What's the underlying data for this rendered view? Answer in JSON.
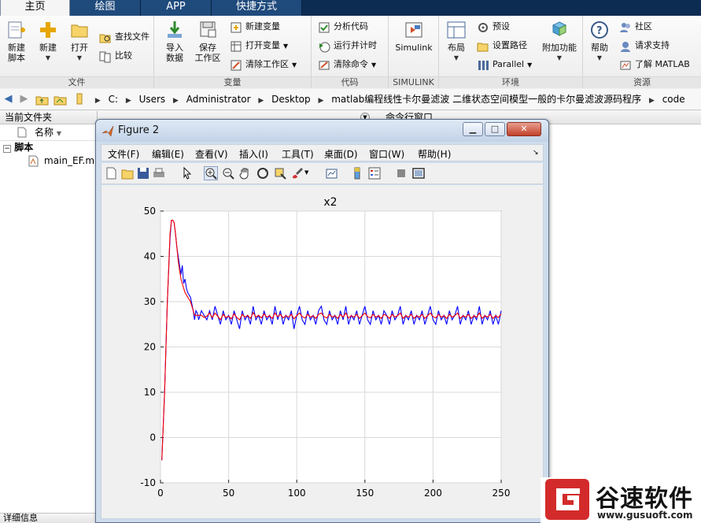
{
  "tabs": [
    "主页",
    "绘图",
    "APP",
    "快捷方式"
  ],
  "ribbon": {
    "file_group": {
      "label": "文件",
      "new_script": "新建\n脚本",
      "new": "新建",
      "open": "打开",
      "find_files": "查找文件",
      "compare": "比较"
    },
    "variable_group": {
      "label": "变量",
      "import_data": "导入\n数据",
      "save_workspace": "保存\n工作区",
      "new_variable": "新建变量",
      "open_variable": "打开变量",
      "clear_workspace": "清除工作区"
    },
    "code_group": {
      "label": "代码",
      "analyze_code": "分析代码",
      "run_and_time": "运行并计时",
      "clear_commands": "清除命令"
    },
    "simulink_group": {
      "label": "SIMULINK",
      "simulink": "Simulink"
    },
    "environment_group": {
      "label": "环境",
      "layout": "布局",
      "preferences": "预设",
      "set_path": "设置路径",
      "parallel": "Parallel",
      "addons": "附加功能"
    },
    "resources_group": {
      "label": "资源",
      "help": "帮助",
      "community": "社区",
      "request_support": "请求支持",
      "learn_matlab": "了解 MATLAB"
    }
  },
  "address": {
    "crumbs": [
      "C:",
      "Users",
      "Administrator",
      "Desktop",
      "matlab编程线性卡尔曼滤波 二维状态空间模型一般的卡尔曼滤波源码程序",
      "code"
    ]
  },
  "left_panel": {
    "title": "当前文件夹",
    "name_column": "名称",
    "section": "脚本",
    "file": "main_EF.m",
    "details": "详细信息"
  },
  "command_window": {
    "title": "命令行窗口"
  },
  "figure": {
    "title": "Figure 2",
    "menu": [
      "文件(F)",
      "编辑(E)",
      "查看(V)",
      "插入(I)",
      "工具(T)",
      "桌面(D)",
      "窗口(W)",
      "帮助(H)"
    ],
    "window_buttons": {
      "minimize": "▁",
      "maximize": "□",
      "close": "✕"
    }
  },
  "chart_data": {
    "type": "line",
    "title": "x2",
    "xlabel": "",
    "ylabel": "",
    "xlim": [
      0,
      250
    ],
    "ylim": [
      -10,
      50
    ],
    "xticks": [
      0,
      50,
      100,
      150,
      200,
      250
    ],
    "yticks": [
      -10,
      0,
      10,
      20,
      30,
      40,
      50
    ],
    "grid": true,
    "series": [
      {
        "color": "#0000ff",
        "points": [
          [
            1,
            -5
          ],
          [
            3,
            10
          ],
          [
            5,
            30
          ],
          [
            7,
            44
          ],
          [
            8,
            48
          ],
          [
            9,
            48
          ],
          [
            10,
            47.5
          ],
          [
            11,
            45
          ],
          [
            12,
            42
          ],
          [
            13,
            40
          ],
          [
            14,
            38
          ],
          [
            15,
            36
          ],
          [
            16,
            38
          ],
          [
            17,
            34
          ],
          [
            18,
            35
          ],
          [
            19,
            33
          ],
          [
            20,
            32
          ],
          [
            22,
            31
          ],
          [
            24,
            28
          ],
          [
            25,
            26
          ],
          [
            26,
            28
          ],
          [
            27,
            27.5
          ],
          [
            28,
            26
          ],
          [
            30,
            28
          ],
          [
            32,
            27
          ],
          [
            34,
            26
          ],
          [
            36,
            28
          ],
          [
            38,
            26
          ],
          [
            40,
            29
          ],
          [
            42,
            27
          ],
          [
            44,
            25
          ],
          [
            46,
            28
          ],
          [
            48,
            26
          ],
          [
            50,
            27
          ],
          [
            52,
            25
          ],
          [
            54,
            28
          ],
          [
            56,
            26
          ],
          [
            58,
            24
          ],
          [
            60,
            28
          ],
          [
            62,
            26
          ],
          [
            64,
            27
          ],
          [
            66,
            25
          ],
          [
            68,
            29
          ],
          [
            70,
            26
          ],
          [
            72,
            27
          ],
          [
            74,
            25
          ],
          [
            76,
            28
          ],
          [
            78,
            26
          ],
          [
            80,
            27
          ],
          [
            82,
            25
          ],
          [
            84,
            29
          ],
          [
            86,
            26
          ],
          [
            88,
            28
          ],
          [
            90,
            25
          ],
          [
            92,
            27
          ],
          [
            94,
            26
          ],
          [
            96,
            28
          ],
          [
            98,
            24
          ],
          [
            100,
            27
          ],
          [
            102,
            29
          ],
          [
            104,
            26
          ],
          [
            106,
            25
          ],
          [
            108,
            28
          ],
          [
            110,
            26
          ],
          [
            112,
            27
          ],
          [
            114,
            25
          ],
          [
            116,
            28
          ],
          [
            118,
            29
          ],
          [
            120,
            26
          ],
          [
            122,
            25
          ],
          [
            124,
            28
          ],
          [
            126,
            26
          ],
          [
            128,
            27
          ],
          [
            130,
            25
          ],
          [
            132,
            28
          ],
          [
            134,
            26
          ],
          [
            136,
            29
          ],
          [
            138,
            25
          ],
          [
            140,
            27
          ],
          [
            142,
            26
          ],
          [
            144,
            28
          ],
          [
            146,
            25
          ],
          [
            148,
            27
          ],
          [
            150,
            29
          ],
          [
            152,
            26
          ],
          [
            154,
            25
          ],
          [
            156,
            28
          ],
          [
            158,
            26
          ],
          [
            160,
            27
          ],
          [
            162,
            25
          ],
          [
            164,
            28
          ],
          [
            166,
            27
          ],
          [
            168,
            25
          ],
          [
            170,
            28
          ],
          [
            172,
            26
          ],
          [
            174,
            27
          ],
          [
            176,
            29
          ],
          [
            178,
            25
          ],
          [
            180,
            27
          ],
          [
            182,
            26
          ],
          [
            184,
            28
          ],
          [
            186,
            25
          ],
          [
            188,
            27
          ],
          [
            190,
            26
          ],
          [
            192,
            28
          ],
          [
            194,
            25
          ],
          [
            196,
            27
          ],
          [
            198,
            29
          ],
          [
            200,
            26
          ],
          [
            202,
            25
          ],
          [
            204,
            28
          ],
          [
            206,
            26
          ],
          [
            208,
            27
          ],
          [
            210,
            25
          ],
          [
            212,
            28
          ],
          [
            214,
            26
          ],
          [
            216,
            27
          ],
          [
            218,
            29
          ],
          [
            220,
            25
          ],
          [
            222,
            27
          ],
          [
            224,
            26
          ],
          [
            226,
            28
          ],
          [
            228,
            25
          ],
          [
            230,
            27
          ],
          [
            232,
            26
          ],
          [
            234,
            29
          ],
          [
            236,
            25
          ],
          [
            238,
            27
          ],
          [
            240,
            26
          ],
          [
            242,
            28
          ],
          [
            244,
            25
          ],
          [
            246,
            27
          ],
          [
            248,
            25
          ],
          [
            250,
            28
          ]
        ]
      },
      {
        "color": "#ff0000",
        "points": [
          [
            1,
            -5
          ],
          [
            3,
            10
          ],
          [
            5,
            30
          ],
          [
            7,
            45
          ],
          [
            8,
            48
          ],
          [
            9,
            48
          ],
          [
            10,
            47.5
          ],
          [
            11,
            45
          ],
          [
            12,
            42
          ],
          [
            13,
            39
          ],
          [
            14,
            37
          ],
          [
            15,
            35
          ],
          [
            16,
            34
          ],
          [
            17,
            33
          ],
          [
            18,
            32
          ],
          [
            20,
            31
          ],
          [
            22,
            30
          ],
          [
            24,
            28
          ],
          [
            25,
            27
          ],
          [
            26,
            27
          ],
          [
            28,
            27
          ],
          [
            30,
            27
          ],
          [
            32,
            26.5
          ],
          [
            34,
            26.8
          ],
          [
            36,
            27.5
          ],
          [
            38,
            26.5
          ],
          [
            40,
            27.5
          ],
          [
            42,
            26.8
          ],
          [
            44,
            26
          ],
          [
            46,
            27.2
          ],
          [
            48,
            26.5
          ],
          [
            50,
            26.8
          ],
          [
            52,
            26.2
          ],
          [
            54,
            27.3
          ],
          [
            56,
            26.5
          ],
          [
            58,
            26
          ],
          [
            60,
            27.2
          ],
          [
            62,
            26.6
          ],
          [
            64,
            27
          ],
          [
            66,
            26.3
          ],
          [
            68,
            27.6
          ],
          [
            70,
            26.6
          ],
          [
            72,
            27
          ],
          [
            74,
            26.4
          ],
          [
            76,
            27.3
          ],
          [
            78,
            26.6
          ],
          [
            80,
            26.9
          ],
          [
            82,
            26.3
          ],
          [
            84,
            27.5
          ],
          [
            86,
            26.7
          ],
          [
            88,
            27.2
          ],
          [
            90,
            26.4
          ],
          [
            92,
            26.9
          ],
          [
            94,
            26.6
          ],
          [
            96,
            27.2
          ],
          [
            98,
            26.2
          ],
          [
            100,
            26.9
          ],
          [
            102,
            27.5
          ],
          [
            104,
            26.7
          ],
          [
            106,
            26.4
          ],
          [
            108,
            27.2
          ],
          [
            110,
            26.6
          ],
          [
            112,
            26.9
          ],
          [
            114,
            26.3
          ],
          [
            116,
            27.2
          ],
          [
            118,
            27.5
          ],
          [
            120,
            26.7
          ],
          [
            122,
            26.4
          ],
          [
            124,
            27.2
          ],
          [
            126,
            26.6
          ],
          [
            128,
            26.9
          ],
          [
            130,
            26.3
          ],
          [
            132,
            27.2
          ],
          [
            134,
            26.6
          ],
          [
            136,
            27.5
          ],
          [
            138,
            26.4
          ],
          [
            140,
            26.9
          ],
          [
            142,
            26.6
          ],
          [
            144,
            27.2
          ],
          [
            146,
            26.3
          ],
          [
            148,
            26.9
          ],
          [
            150,
            27.5
          ],
          [
            152,
            26.7
          ],
          [
            154,
            26.4
          ],
          [
            156,
            27.2
          ],
          [
            158,
            26.6
          ],
          [
            160,
            26.9
          ],
          [
            162,
            26.3
          ],
          [
            164,
            27.2
          ],
          [
            166,
            26.9
          ],
          [
            168,
            26.3
          ],
          [
            170,
            27.2
          ],
          [
            172,
            26.6
          ],
          [
            174,
            26.9
          ],
          [
            176,
            27.5
          ],
          [
            178,
            26.3
          ],
          [
            180,
            26.9
          ],
          [
            182,
            26.6
          ],
          [
            184,
            27.2
          ],
          [
            186,
            26.3
          ],
          [
            188,
            26.9
          ],
          [
            190,
            26.6
          ],
          [
            192,
            27.2
          ],
          [
            194,
            26.3
          ],
          [
            196,
            26.9
          ],
          [
            198,
            27.5
          ],
          [
            200,
            26.7
          ],
          [
            202,
            26.4
          ],
          [
            204,
            27.2
          ],
          [
            206,
            26.6
          ],
          [
            208,
            26.9
          ],
          [
            210,
            26.3
          ],
          [
            212,
            27.2
          ],
          [
            214,
            26.6
          ],
          [
            216,
            26.9
          ],
          [
            218,
            27.5
          ],
          [
            220,
            26.3
          ],
          [
            222,
            26.9
          ],
          [
            224,
            26.6
          ],
          [
            226,
            27.2
          ],
          [
            228,
            26.3
          ],
          [
            230,
            26.9
          ],
          [
            232,
            26.6
          ],
          [
            234,
            27.5
          ],
          [
            236,
            26.3
          ],
          [
            238,
            26.9
          ],
          [
            240,
            26.6
          ],
          [
            242,
            27.2
          ],
          [
            244,
            26.3
          ],
          [
            246,
            26.9
          ],
          [
            248,
            26.5
          ],
          [
            250,
            27.3
          ]
        ]
      }
    ]
  },
  "watermark": {
    "brand": "谷速软件",
    "url": "www.gusuoft.com"
  }
}
